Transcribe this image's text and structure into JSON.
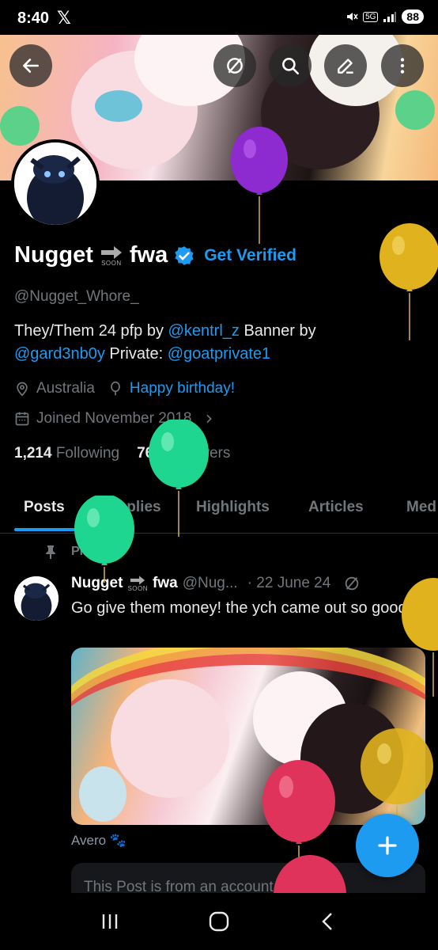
{
  "status_bar": {
    "time": "8:40",
    "network": "5G",
    "battery": "88"
  },
  "banner_buttons": [
    "back-icon",
    "sync-off-icon",
    "search-icon",
    "edit-icon",
    "more-icon"
  ],
  "profile": {
    "display_name_part1": "Nugget",
    "soon_label": "SOON",
    "display_name_part2": "fwa",
    "get_verified": "Get Verified",
    "handle": "@Nugget_Whore_",
    "bio_line1_text": "They/Them 24 pfp by ",
    "bio_line1_link": "@kentrl_z",
    "bio_line1_text2": "  Banner by",
    "bio_line2_link1": "@gard3nb0y",
    "bio_line2_text": "  Private: ",
    "bio_line2_link2": "@goatprivate1",
    "location": "Australia",
    "birthday": "Happy birthday!",
    "joined": "Joined November 2018",
    "following_count": "1,214",
    "following_label": "Following",
    "followers_count": "760",
    "followers_label": "Followers"
  },
  "tabs": [
    "Posts",
    "Replies",
    "Highlights",
    "Articles",
    "Med"
  ],
  "colors": {
    "accent": "#1d9bf0",
    "muted": "#71767b",
    "text": "#e7e9ea"
  },
  "pinned_post": {
    "pinned_label": "Pinned",
    "author_part1": "Nugget",
    "soon_label": "SOON",
    "author_part2": "fwa",
    "handle": "@Nug...",
    "date": "· 22 June 24",
    "text": "Go give them money! the ych came out so good!!",
    "caption": "Avero",
    "notice": "This Post is from an account that no"
  },
  "balloon_colors": [
    "#8e2bd0",
    "#e0b21e",
    "#1fd690",
    "#1fd690",
    "#e0b21e",
    "#e0b21e",
    "#e0335c",
    "#e0335c"
  ]
}
